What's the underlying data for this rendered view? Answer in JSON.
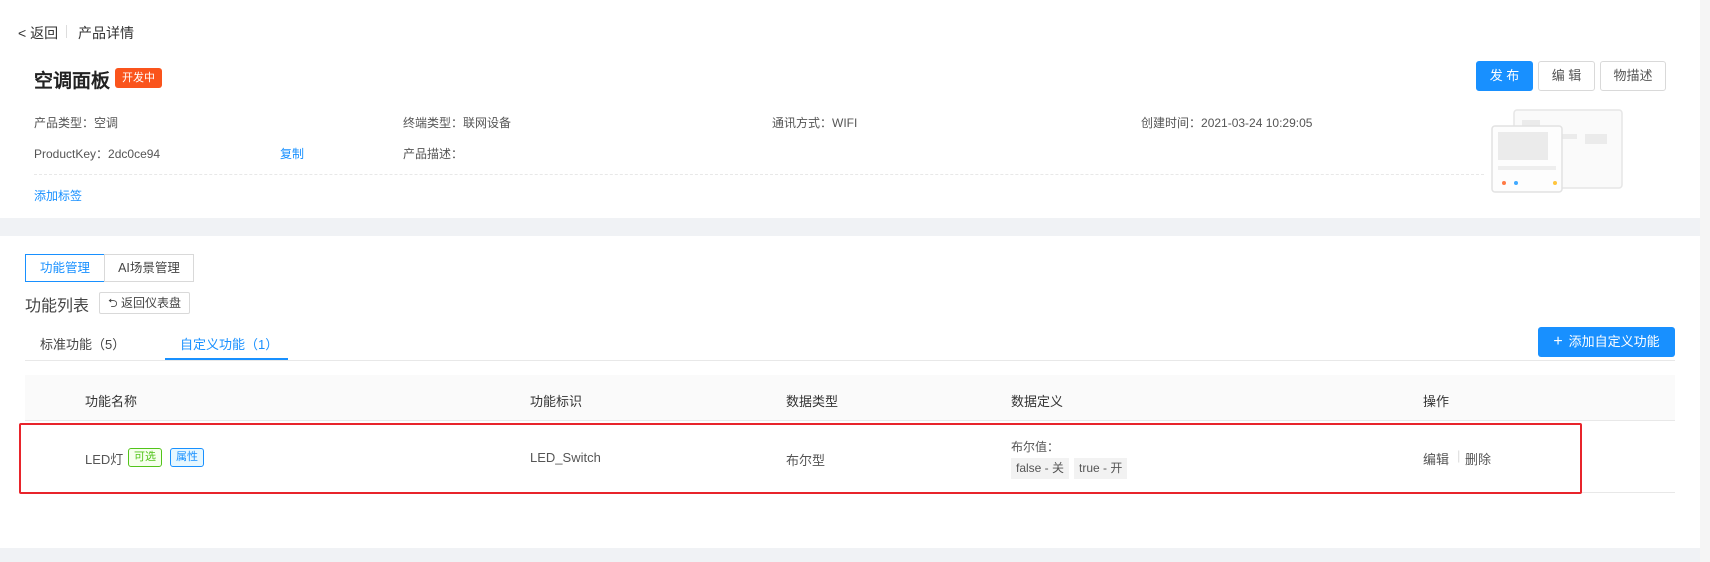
{
  "header": {
    "back_label": "< 返回",
    "breadcrumb": "产品详情",
    "title": "空调面板",
    "status_badge": "开发中",
    "buttons": {
      "publish": "发 布",
      "edit": "编 辑",
      "model": "物描述"
    }
  },
  "info": {
    "product_type_label": "产品类型：",
    "product_type": "空调",
    "terminal_type_label": "终端类型：",
    "terminal_type": "联网设备",
    "comm_label": "通讯方式：",
    "comm": "WIFI",
    "created_label": "创建时间：",
    "created": "2021-03-24 10:29:05",
    "product_key_label": "ProductKey：",
    "product_key": "2dc0ce94",
    "copy": "复制",
    "desc_label": "产品描述：",
    "desc": "",
    "add_tag": "添加标签"
  },
  "segments": {
    "function_mgmt": "功能管理",
    "ai_scene_mgmt": "AI场景管理"
  },
  "list": {
    "title": "功能列表",
    "return_dashboard": "返回仪表盘"
  },
  "tabs": {
    "standard": "标准功能（5）",
    "custom": "自定义功能（1）"
  },
  "add_custom": "添加自定义功能",
  "table": {
    "headers": [
      "功能名称",
      "功能标识",
      "数据类型",
      "数据定义",
      "操作"
    ],
    "rows": [
      {
        "name": "LED灯",
        "tags": [
          "可选",
          "属性"
        ],
        "identifier": "LED_Switch",
        "data_type": "布尔型",
        "definition_label": "布尔值：",
        "values": [
          "false - 关",
          "true - 开"
        ],
        "actions": [
          "编辑",
          "删除"
        ]
      }
    ]
  },
  "colors": {
    "accent": "#1890ff",
    "status": "#fa541c",
    "highlight": "#e8242b"
  }
}
